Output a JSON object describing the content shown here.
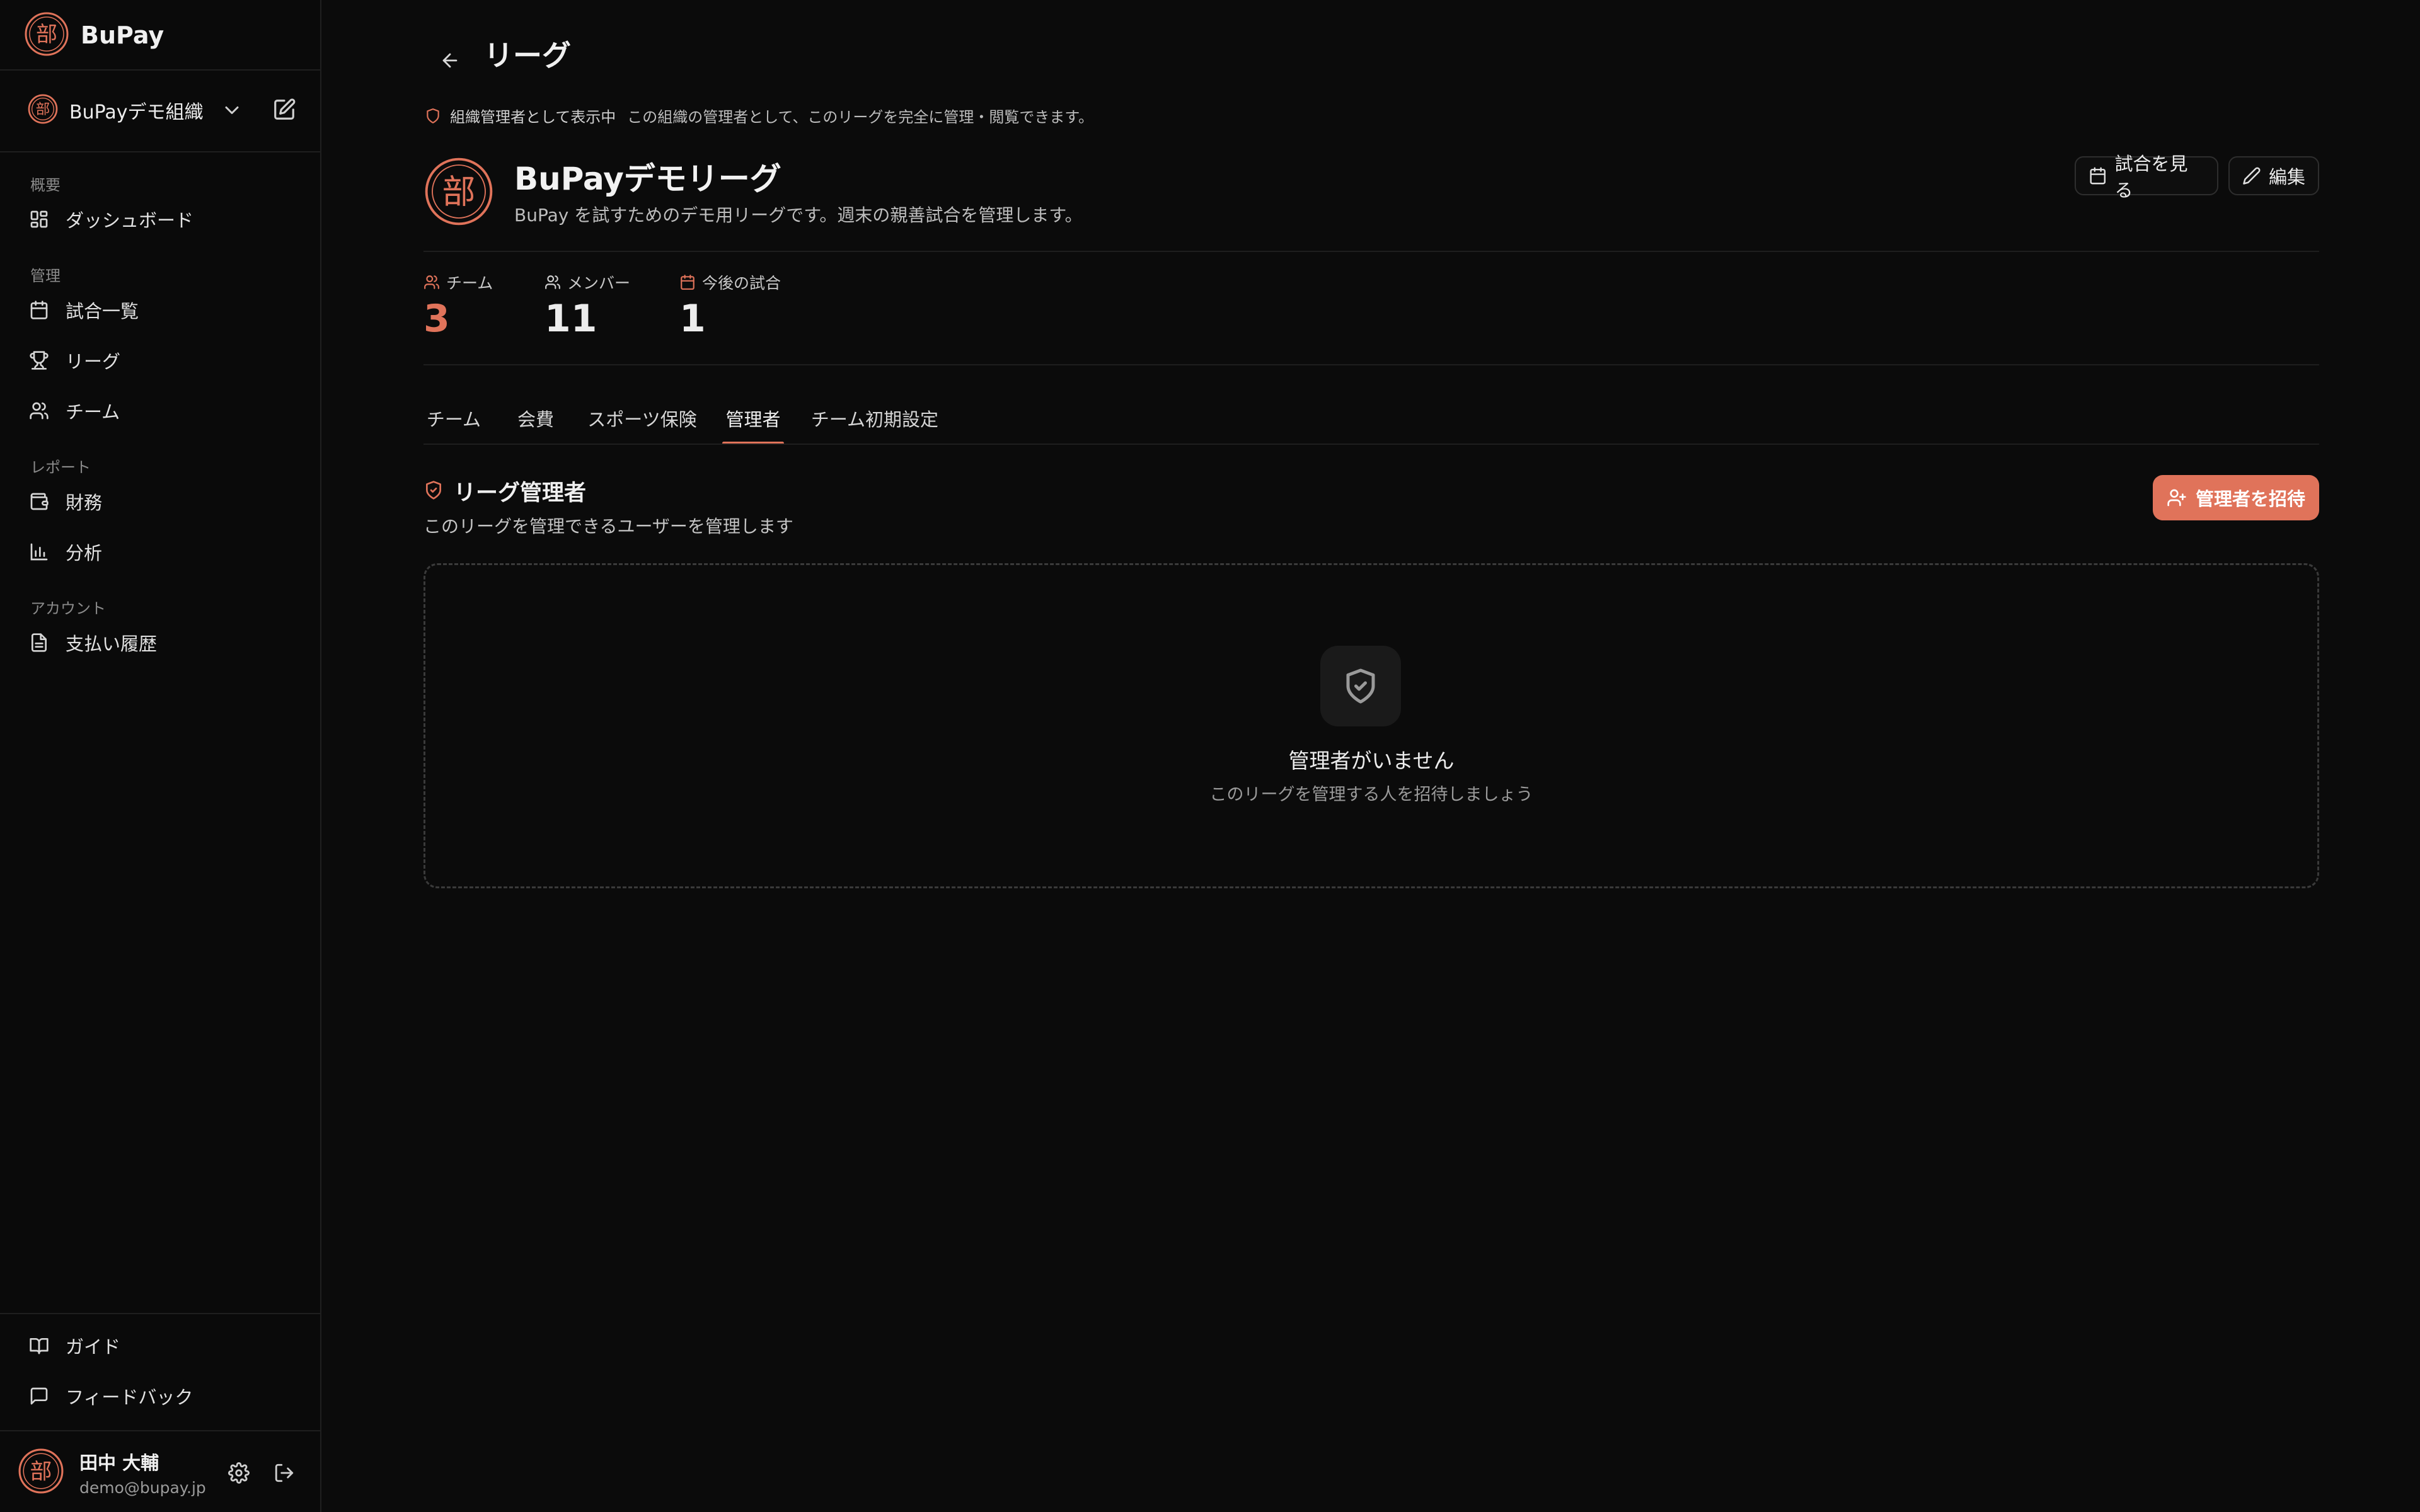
{
  "app": {
    "name": "BuPay",
    "brand_mark": "部"
  },
  "colors": {
    "accent": "#e0735a",
    "background": "#0b0b0b",
    "sidebar": "#0a0a0a",
    "muted": "#9a9a9a"
  },
  "sidebar": {
    "org": {
      "name": "BuPayデモ組織"
    },
    "sections": [
      {
        "label": "概要",
        "items": [
          {
            "label": "ダッシュボード",
            "icon": "dashboard-icon"
          }
        ]
      },
      {
        "label": "管理",
        "items": [
          {
            "label": "試合一覧",
            "icon": "calendar-icon"
          },
          {
            "label": "リーグ",
            "icon": "trophy-icon"
          },
          {
            "label": "チーム",
            "icon": "users-icon"
          }
        ]
      },
      {
        "label": "レポート",
        "items": [
          {
            "label": "財務",
            "icon": "wallet-icon"
          },
          {
            "label": "分析",
            "icon": "bar-chart-icon"
          }
        ]
      },
      {
        "label": "アカウント",
        "items": [
          {
            "label": "支払い履歴",
            "icon": "receipt-icon"
          }
        ]
      }
    ],
    "footer": [
      {
        "label": "ガイド",
        "icon": "book-icon"
      },
      {
        "label": "フィードバック",
        "icon": "message-icon"
      }
    ],
    "user": {
      "name": "田中 大輔",
      "email": "demo@bupay.jp"
    }
  },
  "header": {
    "title": "リーグ"
  },
  "notice": {
    "label": "組織管理者として表示中",
    "text": "この組織の管理者として、このリーグを完全に管理・閲覧できます。"
  },
  "league": {
    "name": "BuPayデモリーグ",
    "description": "BuPay を試すためのデモ用リーグです。週末の親善試合を管理します。",
    "actions": {
      "view_matches": "試合を見る",
      "edit": "編集"
    }
  },
  "stats": [
    {
      "label": "チーム",
      "value": "3",
      "icon": "users-icon"
    },
    {
      "label": "メンバー",
      "value": "11",
      "icon": "users-icon"
    },
    {
      "label": "今後の試合",
      "value": "1",
      "icon": "calendar-icon"
    }
  ],
  "tabs": [
    {
      "label": "チーム",
      "active": false
    },
    {
      "label": "会費",
      "active": false
    },
    {
      "label": "スポーツ保険",
      "active": false
    },
    {
      "label": "管理者",
      "active": true
    },
    {
      "label": "チーム初期設定",
      "active": false
    }
  ],
  "admins_section": {
    "title": "リーグ管理者",
    "description": "このリーグを管理できるユーザーを管理します",
    "invite_button": "管理者を招待",
    "empty": {
      "title": "管理者がいません",
      "subtitle": "このリーグを管理する人を招待しましょう"
    }
  }
}
